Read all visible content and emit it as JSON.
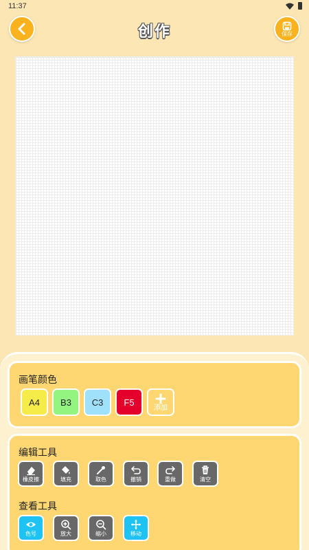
{
  "status_bar": {
    "time": "11:37"
  },
  "header": {
    "title": "创作",
    "save_label": "保存"
  },
  "brush_colors": {
    "title": "画笔颜色",
    "swatches": [
      {
        "code": "A4",
        "color": "#f6ec49"
      },
      {
        "code": "B3",
        "color": "#93f57f"
      },
      {
        "code": "C3",
        "color": "#9fe0fb"
      },
      {
        "code": "F5",
        "color": "#e4002b"
      }
    ],
    "add_label": "添加"
  },
  "edit_tools": {
    "title": "编辑工具",
    "items": [
      {
        "label": "橡皮擦",
        "icon": "eraser-icon"
      },
      {
        "label": "填充",
        "icon": "paint-bucket-icon"
      },
      {
        "label": "取色",
        "icon": "eyedropper-icon"
      },
      {
        "label": "撤销",
        "icon": "undo-icon"
      },
      {
        "label": "重做",
        "icon": "redo-icon"
      },
      {
        "label": "清空",
        "icon": "trash-icon"
      }
    ]
  },
  "view_tools": {
    "title": "查看工具",
    "items": [
      {
        "label": "色号",
        "icon": "eye-icon",
        "active": true
      },
      {
        "label": "放大",
        "icon": "zoom-in-icon",
        "active": false
      },
      {
        "label": "缩小",
        "icon": "zoom-out-icon",
        "active": false
      },
      {
        "label": "移动",
        "icon": "move-icon",
        "active": true
      }
    ]
  },
  "colors": {
    "accent": "#fbb21f",
    "card": "#fed772",
    "tool": "#686868",
    "tool_active": "#1ec3f4"
  }
}
